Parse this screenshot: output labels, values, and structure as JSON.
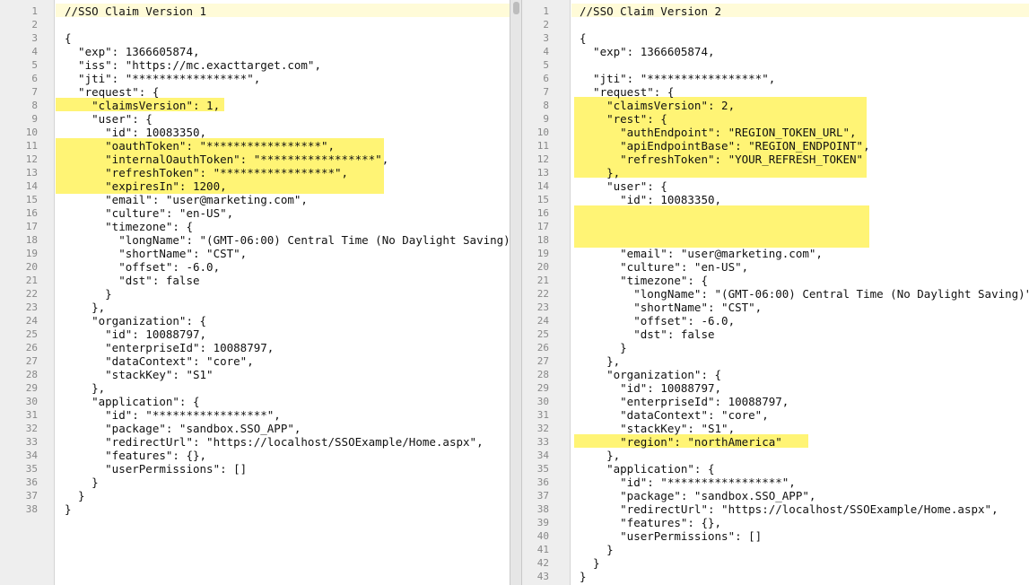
{
  "left": {
    "lines": [
      "//SSO Claim Version 1",
      "",
      "{",
      "  \"exp\": 1366605874,",
      "  \"iss\": \"https://mc.exacttarget.com\",",
      "  \"jti\": \"*****************\",",
      "  \"request\": {",
      "    \"claimsVersion\": 1,",
      "    \"user\": {",
      "      \"id\": 10083350,",
      "      \"oauthToken\": \"*****************\",",
      "      \"internalOauthToken\": \"*****************\",",
      "      \"refreshToken\": \"*****************\",",
      "      \"expiresIn\": 1200,",
      "      \"email\": \"user@marketing.com\",",
      "      \"culture\": \"en-US\",",
      "      \"timezone\": {",
      "        \"longName\": \"(GMT-06:00) Central Time (No Daylight Saving)\",",
      "        \"shortName\": \"CST\",",
      "        \"offset\": -6.0,",
      "        \"dst\": false",
      "      }",
      "    },",
      "    \"organization\": {",
      "      \"id\": 10088797,",
      "      \"enterpriseId\": 10088797,",
      "      \"dataContext\": \"core\",",
      "      \"stackKey\": \"S1\"",
      "    },",
      "    \"application\": {",
      "      \"id\": \"*****************\",",
      "      \"package\": \"sandbox.SSO_APP\",",
      "      \"redirectUrl\": \"https://localhost/SSOExample/Home.aspx\",",
      "      \"features\": {},",
      "      \"userPermissions\": []",
      "    }",
      "  }",
      "}"
    ]
  },
  "right": {
    "lines": [
      "//SSO Claim Version 2",
      "",
      "{",
      "  \"exp\": 1366605874,",
      "",
      "  \"jti\": \"*****************\",",
      "  \"request\": {",
      "    \"claimsVersion\": 2,",
      "    \"rest\": {",
      "      \"authEndpoint\": \"REGION_TOKEN_URL\",",
      "      \"apiEndpointBase\": \"REGION_ENDPOINT\",",
      "      \"refreshToken\": \"YOUR_REFRESH_TOKEN\"",
      "    },",
      "    \"user\": {",
      "      \"id\": 10083350,",
      "",
      "",
      "",
      "      \"email\": \"user@marketing.com\",",
      "      \"culture\": \"en-US\",",
      "      \"timezone\": {",
      "        \"longName\": \"(GMT-06:00) Central Time (No Daylight Saving)\",",
      "        \"shortName\": \"CST\",",
      "        \"offset\": -6.0,",
      "        \"dst\": false",
      "      }",
      "    },",
      "    \"organization\": {",
      "      \"id\": 10088797,",
      "      \"enterpriseId\": 10088797,",
      "      \"dataContext\": \"core\",",
      "      \"stackKey\": \"S1\",",
      "      \"region\": \"northAmerica\"",
      "    },",
      "    \"application\": {",
      "      \"id\": \"*****************\",",
      "      \"package\": \"sandbox.SSO_APP\",",
      "      \"redirectUrl\": \"https://localhost/SSOExample/Home.aspx\",",
      "      \"features\": {},",
      "      \"userPermissions\": []",
      "    }",
      "  }",
      "}"
    ]
  },
  "colors": {
    "highlight": "#fff475",
    "current_line": "#fffbd8",
    "gutter": "#eeeeee"
  }
}
